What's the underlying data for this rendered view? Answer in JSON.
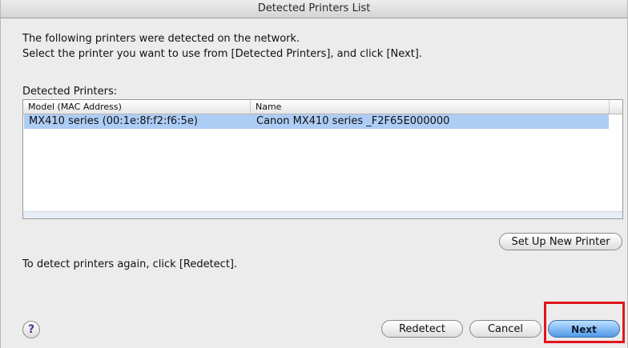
{
  "window": {
    "title": "Detected Printers List"
  },
  "intro": {
    "line1": "The following printers were detected on the network.",
    "line2": "Select the printer you want to use from [Detected Printers], and click [Next]."
  },
  "detected_printers": {
    "label": "Detected Printers:",
    "columns": [
      "Model (MAC Address)",
      "Name"
    ],
    "rows": [
      {
        "model": "MX410 series (00:1e:8f:f2:f6:5e)",
        "name": "Canon MX410 series _F2F65E000000",
        "selected": true
      }
    ]
  },
  "buttons": {
    "setup_new_printer": "Set Up New Printer",
    "redetect": "Redetect",
    "cancel": "Cancel",
    "next": "Next",
    "help": "?"
  },
  "redetect_hint": "To detect printers again, click [Redetect].",
  "colors": {
    "selection": "#aecdf5",
    "highlight_box": "#e2141b",
    "default_button": "#4f9ae8"
  }
}
